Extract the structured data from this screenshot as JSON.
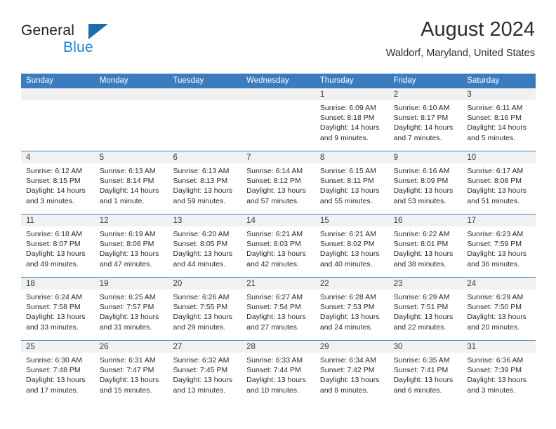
{
  "brand": {
    "name_part1": "General",
    "name_part2": "Blue",
    "triangle_color": "#1f6bb0",
    "blue_color": "#2083d4"
  },
  "header": {
    "title": "August 2024",
    "subtitle": "Waldorf, Maryland, United States"
  },
  "theme": {
    "header_blue": "#3a7cbe",
    "day_strip_gray": "#f1f1f1"
  },
  "calendar": {
    "weekdays": [
      "Sunday",
      "Monday",
      "Tuesday",
      "Wednesday",
      "Thursday",
      "Friday",
      "Saturday"
    ],
    "weeks": [
      [
        {
          "day": "",
          "empty": true,
          "sunrise": "",
          "sunset": "",
          "daylight1": "",
          "daylight2": ""
        },
        {
          "day": "",
          "empty": true,
          "sunrise": "",
          "sunset": "",
          "daylight1": "",
          "daylight2": ""
        },
        {
          "day": "",
          "empty": true,
          "sunrise": "",
          "sunset": "",
          "daylight1": "",
          "daylight2": ""
        },
        {
          "day": "",
          "empty": true,
          "sunrise": "",
          "sunset": "",
          "daylight1": "",
          "daylight2": ""
        },
        {
          "day": "1",
          "empty": false,
          "sunrise": "Sunrise: 6:09 AM",
          "sunset": "Sunset: 8:18 PM",
          "daylight1": "Daylight: 14 hours",
          "daylight2": "and 9 minutes."
        },
        {
          "day": "2",
          "empty": false,
          "sunrise": "Sunrise: 6:10 AM",
          "sunset": "Sunset: 8:17 PM",
          "daylight1": "Daylight: 14 hours",
          "daylight2": "and 7 minutes."
        },
        {
          "day": "3",
          "empty": false,
          "sunrise": "Sunrise: 6:11 AM",
          "sunset": "Sunset: 8:16 PM",
          "daylight1": "Daylight: 14 hours",
          "daylight2": "and 5 minutes."
        }
      ],
      [
        {
          "day": "4",
          "empty": false,
          "sunrise": "Sunrise: 6:12 AM",
          "sunset": "Sunset: 8:15 PM",
          "daylight1": "Daylight: 14 hours",
          "daylight2": "and 3 minutes."
        },
        {
          "day": "5",
          "empty": false,
          "sunrise": "Sunrise: 6:13 AM",
          "sunset": "Sunset: 8:14 PM",
          "daylight1": "Daylight: 14 hours",
          "daylight2": "and 1 minute."
        },
        {
          "day": "6",
          "empty": false,
          "sunrise": "Sunrise: 6:13 AM",
          "sunset": "Sunset: 8:13 PM",
          "daylight1": "Daylight: 13 hours",
          "daylight2": "and 59 minutes."
        },
        {
          "day": "7",
          "empty": false,
          "sunrise": "Sunrise: 6:14 AM",
          "sunset": "Sunset: 8:12 PM",
          "daylight1": "Daylight: 13 hours",
          "daylight2": "and 57 minutes."
        },
        {
          "day": "8",
          "empty": false,
          "sunrise": "Sunrise: 6:15 AM",
          "sunset": "Sunset: 8:11 PM",
          "daylight1": "Daylight: 13 hours",
          "daylight2": "and 55 minutes."
        },
        {
          "day": "9",
          "empty": false,
          "sunrise": "Sunrise: 6:16 AM",
          "sunset": "Sunset: 8:09 PM",
          "daylight1": "Daylight: 13 hours",
          "daylight2": "and 53 minutes."
        },
        {
          "day": "10",
          "empty": false,
          "sunrise": "Sunrise: 6:17 AM",
          "sunset": "Sunset: 8:08 PM",
          "daylight1": "Daylight: 13 hours",
          "daylight2": "and 51 minutes."
        }
      ],
      [
        {
          "day": "11",
          "empty": false,
          "sunrise": "Sunrise: 6:18 AM",
          "sunset": "Sunset: 8:07 PM",
          "daylight1": "Daylight: 13 hours",
          "daylight2": "and 49 minutes."
        },
        {
          "day": "12",
          "empty": false,
          "sunrise": "Sunrise: 6:19 AM",
          "sunset": "Sunset: 8:06 PM",
          "daylight1": "Daylight: 13 hours",
          "daylight2": "and 47 minutes."
        },
        {
          "day": "13",
          "empty": false,
          "sunrise": "Sunrise: 6:20 AM",
          "sunset": "Sunset: 8:05 PM",
          "daylight1": "Daylight: 13 hours",
          "daylight2": "and 44 minutes."
        },
        {
          "day": "14",
          "empty": false,
          "sunrise": "Sunrise: 6:21 AM",
          "sunset": "Sunset: 8:03 PM",
          "daylight1": "Daylight: 13 hours",
          "daylight2": "and 42 minutes."
        },
        {
          "day": "15",
          "empty": false,
          "sunrise": "Sunrise: 6:21 AM",
          "sunset": "Sunset: 8:02 PM",
          "daylight1": "Daylight: 13 hours",
          "daylight2": "and 40 minutes."
        },
        {
          "day": "16",
          "empty": false,
          "sunrise": "Sunrise: 6:22 AM",
          "sunset": "Sunset: 8:01 PM",
          "daylight1": "Daylight: 13 hours",
          "daylight2": "and 38 minutes."
        },
        {
          "day": "17",
          "empty": false,
          "sunrise": "Sunrise: 6:23 AM",
          "sunset": "Sunset: 7:59 PM",
          "daylight1": "Daylight: 13 hours",
          "daylight2": "and 36 minutes."
        }
      ],
      [
        {
          "day": "18",
          "empty": false,
          "sunrise": "Sunrise: 6:24 AM",
          "sunset": "Sunset: 7:58 PM",
          "daylight1": "Daylight: 13 hours",
          "daylight2": "and 33 minutes."
        },
        {
          "day": "19",
          "empty": false,
          "sunrise": "Sunrise: 6:25 AM",
          "sunset": "Sunset: 7:57 PM",
          "daylight1": "Daylight: 13 hours",
          "daylight2": "and 31 minutes."
        },
        {
          "day": "20",
          "empty": false,
          "sunrise": "Sunrise: 6:26 AM",
          "sunset": "Sunset: 7:55 PM",
          "daylight1": "Daylight: 13 hours",
          "daylight2": "and 29 minutes."
        },
        {
          "day": "21",
          "empty": false,
          "sunrise": "Sunrise: 6:27 AM",
          "sunset": "Sunset: 7:54 PM",
          "daylight1": "Daylight: 13 hours",
          "daylight2": "and 27 minutes."
        },
        {
          "day": "22",
          "empty": false,
          "sunrise": "Sunrise: 6:28 AM",
          "sunset": "Sunset: 7:53 PM",
          "daylight1": "Daylight: 13 hours",
          "daylight2": "and 24 minutes."
        },
        {
          "day": "23",
          "empty": false,
          "sunrise": "Sunrise: 6:29 AM",
          "sunset": "Sunset: 7:51 PM",
          "daylight1": "Daylight: 13 hours",
          "daylight2": "and 22 minutes."
        },
        {
          "day": "24",
          "empty": false,
          "sunrise": "Sunrise: 6:29 AM",
          "sunset": "Sunset: 7:50 PM",
          "daylight1": "Daylight: 13 hours",
          "daylight2": "and 20 minutes."
        }
      ],
      [
        {
          "day": "25",
          "empty": false,
          "sunrise": "Sunrise: 6:30 AM",
          "sunset": "Sunset: 7:48 PM",
          "daylight1": "Daylight: 13 hours",
          "daylight2": "and 17 minutes."
        },
        {
          "day": "26",
          "empty": false,
          "sunrise": "Sunrise: 6:31 AM",
          "sunset": "Sunset: 7:47 PM",
          "daylight1": "Daylight: 13 hours",
          "daylight2": "and 15 minutes."
        },
        {
          "day": "27",
          "empty": false,
          "sunrise": "Sunrise: 6:32 AM",
          "sunset": "Sunset: 7:45 PM",
          "daylight1": "Daylight: 13 hours",
          "daylight2": "and 13 minutes."
        },
        {
          "day": "28",
          "empty": false,
          "sunrise": "Sunrise: 6:33 AM",
          "sunset": "Sunset: 7:44 PM",
          "daylight1": "Daylight: 13 hours",
          "daylight2": "and 10 minutes."
        },
        {
          "day": "29",
          "empty": false,
          "sunrise": "Sunrise: 6:34 AM",
          "sunset": "Sunset: 7:42 PM",
          "daylight1": "Daylight: 13 hours",
          "daylight2": "and 8 minutes."
        },
        {
          "day": "30",
          "empty": false,
          "sunrise": "Sunrise: 6:35 AM",
          "sunset": "Sunset: 7:41 PM",
          "daylight1": "Daylight: 13 hours",
          "daylight2": "and 6 minutes."
        },
        {
          "day": "31",
          "empty": false,
          "sunrise": "Sunrise: 6:36 AM",
          "sunset": "Sunset: 7:39 PM",
          "daylight1": "Daylight: 13 hours",
          "daylight2": "and 3 minutes."
        }
      ]
    ]
  }
}
